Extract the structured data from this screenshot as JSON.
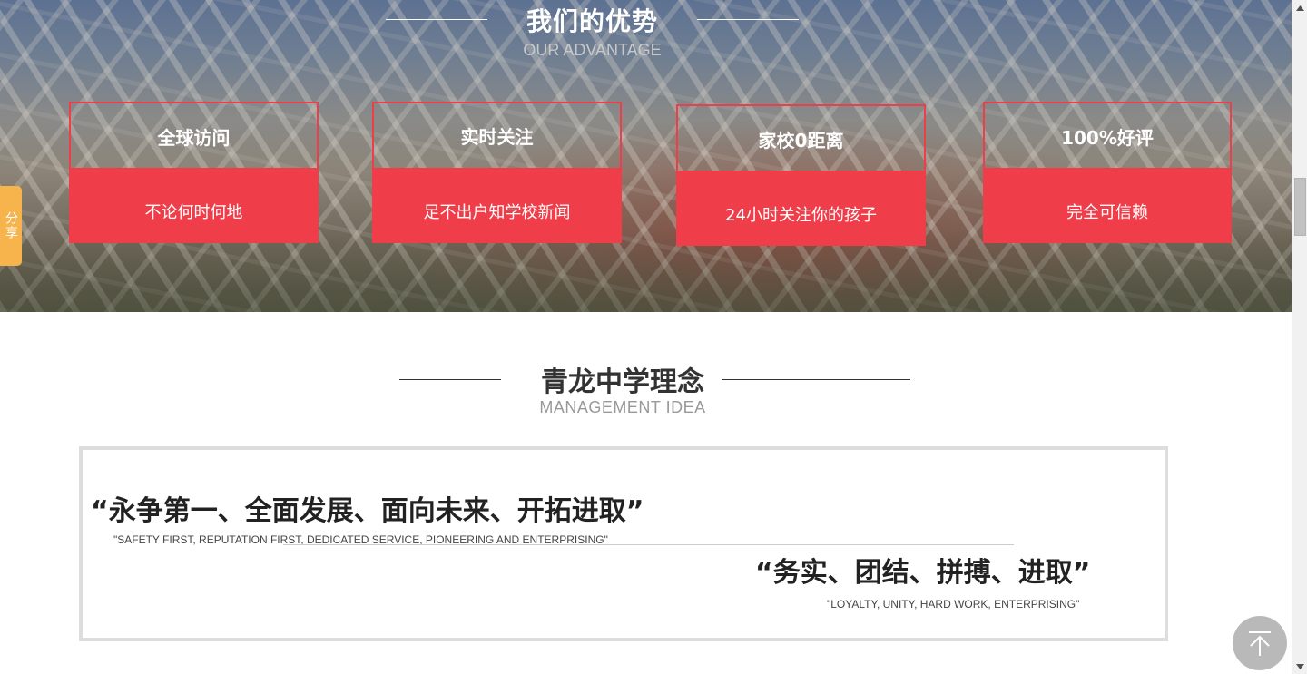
{
  "advantage": {
    "title": "我们的优势",
    "subtitle": "OUR ADVANTAGE",
    "cards": [
      {
        "title": "全球访问",
        "desc": "不论何时何地"
      },
      {
        "title": "实时关注",
        "desc": "足不出户知学校新闻"
      },
      {
        "title": "家校0距离",
        "desc": "24小时关注你的孩子"
      },
      {
        "title": "100%好评",
        "desc": "完全可信赖"
      }
    ]
  },
  "share": {
    "label": "分享"
  },
  "idea": {
    "title": "青龙中学理念",
    "subtitle": "MANAGEMENT IDEA",
    "motto1": "“永争第一、全面发展、面向未来、开拓进取”",
    "motto1_en": "\"SAFETY FIRST, REPUTATION FIRST, DEDICATED SERVICE, PIONEERING AND ENTERPRISING\"",
    "motto2": "“务实、团结、拼搏、进取”",
    "motto2_en": "\"LOYALTY, UNITY, HARD WORK, ENTERPRISING\""
  },
  "icons": {
    "back_top": "arrow-up-to-top-icon",
    "scroll_up": "triangle-up-icon",
    "scroll_down": "triangle-down-icon"
  },
  "colors": {
    "accent_red": "#ef3e4a",
    "share_orange": "#f7b44c",
    "back_top_gray": "#b9b9b9"
  }
}
